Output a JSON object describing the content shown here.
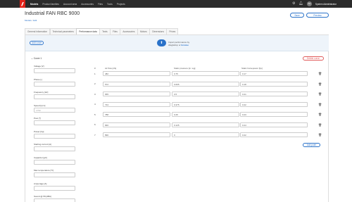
{
  "nav": {
    "items": [
      "Models",
      "Product families",
      "Account area",
      "Accessories",
      "Files",
      "Tools",
      "Projects"
    ],
    "active": "Models",
    "user_initials": "SA",
    "user_name": "System Administrator",
    "icons": [
      "gear-icon",
      "bell-icon"
    ]
  },
  "header": {
    "title": "Industrial FAN RBC 9000",
    "breadcrumb_root": "Models",
    "breadcrumb_sep": "/",
    "breadcrumb_current": "Edit",
    "save_label": "Save",
    "preview_label": "Preview"
  },
  "tabs": [
    "General information",
    "Technical parameters",
    "Performance data",
    "Texts",
    "Files",
    "Accessories",
    "Motors",
    "Dimensions",
    "Prices"
  ],
  "active_tab": "Performance data",
  "import": {
    "add_curve": "Add curve",
    "line1": "Import performance by",
    "line2_pre": "drag&drop or ",
    "line2_link": "browse"
  },
  "curve": {
    "title": "Curve 1",
    "delete_label": "Delete curve",
    "add_point_label": "Add point",
    "fields": [
      {
        "label": "Voltage [V]",
        "value": ""
      },
      {
        "label": "Phase [-]",
        "value": ""
      },
      {
        "label": "Frequency [Hz]",
        "value": ""
      },
      {
        "label": "Speed [rpm]",
        "value": "1750"
      },
      {
        "label": "Pout [*]",
        "value": ""
      },
      {
        "label": "Power [hp]",
        "value": ""
      },
      {
        "label": "Starting current [A]",
        "value": ""
      },
      {
        "label": "Capacitor [µF]",
        "value": ""
      },
      {
        "label": "Max temperature [°F]",
        "value": ""
      },
      {
        "label": "Amperage [A]",
        "value": ""
      },
      {
        "label": "Sound @ 5ft [dBA]",
        "value": ""
      }
    ],
    "columns": [
      "#",
      "Air flow [cfs]",
      "Static pressure [in. wg]",
      "Static horsepower [hp]"
    ],
    "rows": [
      {
        "n": "1",
        "flow": "482",
        "pressure": "0.75",
        "hp": "0.17"
      },
      {
        "n": "2",
        "flow": "572",
        "pressure": "0.605",
        "hp": "0.18"
      },
      {
        "n": "3",
        "flow": "655",
        "pressure": "0.5",
        "hp": "0.21"
      },
      {
        "n": "4",
        "flow": "724",
        "pressure": "0.375",
        "hp": "0.22"
      },
      {
        "n": "5",
        "flow": "788",
        "pressure": "0.25",
        "hp": "0.23"
      },
      {
        "n": "6",
        "flow": "846",
        "pressure": "0.125",
        "hp": "0.24"
      },
      {
        "n": "7",
        "flow": "896",
        "pressure": "0",
        "hp": "0.22"
      }
    ]
  },
  "colors": {
    "nav_bg": "#2b2b2b",
    "brand": "#e2231a",
    "accent": "#2a72c9",
    "delete": "#e05a5a"
  }
}
